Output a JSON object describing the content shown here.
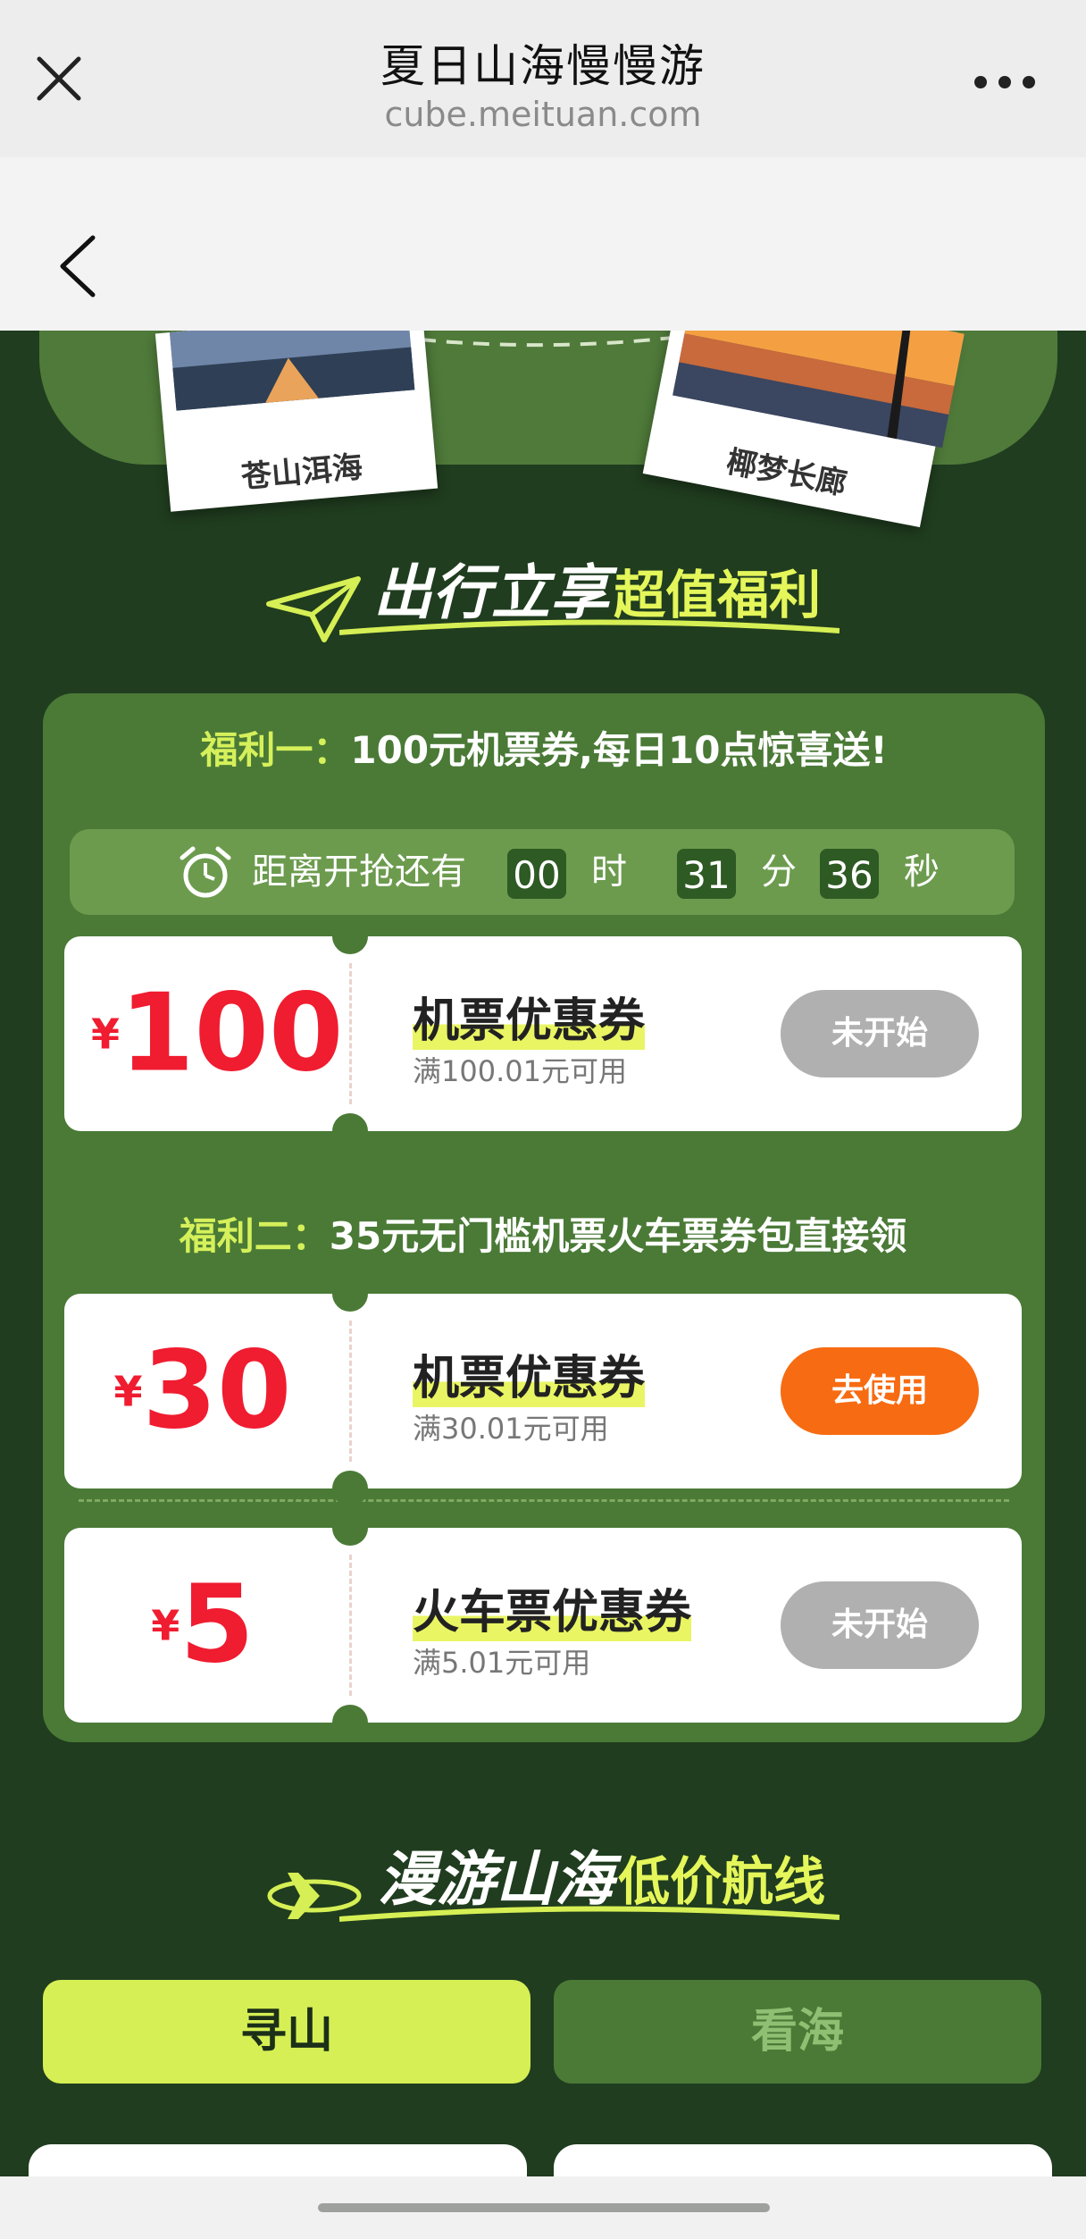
{
  "browser": {
    "title": "夏日山海慢慢游",
    "url": "cube.meituan.com"
  },
  "hero": {
    "photo_left_caption": "苍山洱海",
    "photo_right_caption": "椰梦长廊"
  },
  "section1": {
    "script_text": "出行立享",
    "highlight_text": "超值福利"
  },
  "benefit1": {
    "label": "福利一：",
    "text": "100元机票券,每日10点惊喜送!",
    "countdown": {
      "prefix": "距离开抢还有",
      "hours": "00",
      "hours_unit": "时",
      "minutes": "31",
      "minutes_unit": "分",
      "seconds": "36",
      "seconds_unit": "秒"
    },
    "coupon": {
      "currency": "¥",
      "amount": "100",
      "name": "机票优惠券",
      "condition": "满100.01元可用",
      "button": "未开始"
    }
  },
  "benefit2": {
    "label": "福利二：",
    "text": "35元无门槛机票火车票券包直接领",
    "coupons": [
      {
        "currency": "¥",
        "amount": "30",
        "name": "机票优惠券",
        "condition": "满30.01元可用",
        "button": "去使用"
      },
      {
        "currency": "¥",
        "amount": "5",
        "name": "火车票优惠券",
        "condition": "满5.01元可用",
        "button": "未开始"
      }
    ]
  },
  "section2": {
    "script_text": "漫游山海",
    "highlight_text": "低价航线"
  },
  "tabs": [
    {
      "label": "寻山",
      "active": true
    },
    {
      "label": "看海",
      "active": false
    }
  ],
  "colors": {
    "background": "#203d1f",
    "panel": "#4a7a36",
    "accent": "#d6ef54",
    "price": "#f01c30",
    "cta": "#f76b12"
  },
  "icons": [
    "close-icon",
    "more-icon",
    "back-icon",
    "paper-plane-icon",
    "alarm-clock-icon",
    "airplane-icon"
  ]
}
